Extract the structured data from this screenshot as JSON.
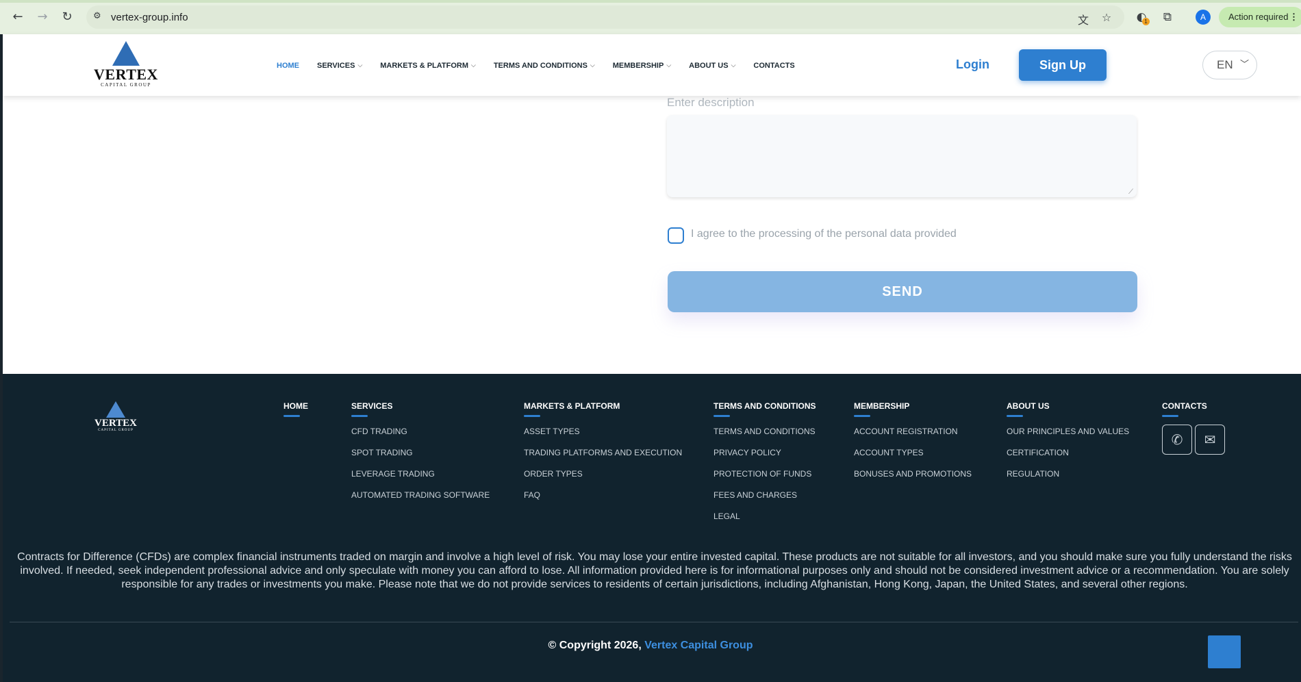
{
  "browser": {
    "url": "vertex-group.info",
    "avatar_letter": "A",
    "action_pill": "Action required",
    "ext_badge": "1"
  },
  "header": {
    "logo_word": "VERTEX",
    "logo_sub": "CAPITAL GROUP",
    "nav": [
      {
        "label": "HOME",
        "dropdown": false
      },
      {
        "label": "SERVICES",
        "dropdown": true
      },
      {
        "label": "MARKETS & PLATFORM",
        "dropdown": true
      },
      {
        "label": "TERMS AND CONDITIONS",
        "dropdown": true
      },
      {
        "label": "MEMBERSHIP",
        "dropdown": true
      },
      {
        "label": "ABOUT US",
        "dropdown": true
      },
      {
        "label": "CONTACTS",
        "dropdown": false
      }
    ],
    "login_label": "Login",
    "signup_label": "Sign Up",
    "language": "EN"
  },
  "form": {
    "description_placeholder": "Enter description",
    "agree_label": "I agree to the processing of the personal data provided",
    "send_label": "SEND"
  },
  "footer": {
    "logo_word": "VERTEX",
    "logo_sub": "CAPITAL GROUP",
    "columns": {
      "home": {
        "head": "HOME",
        "links": []
      },
      "services": {
        "head": "SERVICES",
        "links": [
          "CFD TRADING",
          "SPOT TRADING",
          "LEVERAGE TRADING",
          "AUTOMATED TRADING SOFTWARE"
        ]
      },
      "markets": {
        "head": "MARKETS & PLATFORM",
        "links": [
          "ASSET TYPES",
          "TRADING PLATFORMS AND EXECUTION",
          "ORDER TYPES",
          "FAQ"
        ]
      },
      "terms": {
        "head": "TERMS AND CONDITIONS",
        "links": [
          "TERMS AND CONDITIONS",
          "PRIVACY POLICY",
          "PROTECTION OF FUNDS",
          "FEES AND CHARGES",
          "LEGAL"
        ]
      },
      "membership": {
        "head": "MEMBERSHIP",
        "links": [
          "ACCOUNT REGISTRATION",
          "ACCOUNT TYPES",
          "BONUSES AND PROMOTIONS"
        ]
      },
      "about": {
        "head": "ABOUT US",
        "links": [
          "OUR PRINCIPLES AND VALUES",
          "CERTIFICATION",
          "REGULATION"
        ]
      },
      "contacts": {
        "head": "CONTACTS",
        "links": []
      }
    },
    "disclaimer": "Contracts for Difference (CFDs) are complex financial instruments traded on margin and involve a high level of risk. You may lose your entire invested capital. These products are not suitable for all investors, and you should make sure you fully understand the risks involved. If needed, seek independent professional advice and only speculate with money you can afford to lose. All information provided here is for informational purposes only and should not be considered investment advice or a recommendation. You are solely responsible for any trades or investments you make. Please note that we do not provide services to residents of certain jurisdictions, including Afghanistan, Hong Kong, Japan, the United States, and several other regions.",
    "copyright_prefix": "© Copyright 2026,",
    "copyright_brand": "Vertex Capital Group"
  },
  "icons": {
    "back": "back-arrow-icon",
    "forward": "forward-arrow-icon",
    "reload": "reload-icon",
    "site_info": "site-info-icon",
    "translate": "translate-icon",
    "bookmark": "star-icon",
    "extension": "puzzle-icon",
    "phone": "phone-icon",
    "mail": "mail-icon"
  },
  "colors": {
    "accent": "#2e7fd0",
    "send_button": "#85b5e2",
    "footer_bg": "#11232e"
  }
}
